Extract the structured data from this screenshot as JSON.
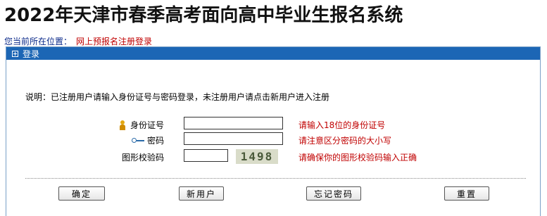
{
  "page": {
    "title": "2022年天津市春季高考面向高中毕业生报名系统",
    "location_label": "您当前所在位置：",
    "location_current": "网上预报名注册登录"
  },
  "panel": {
    "header": "登录",
    "note": "说明：已注册用户请输入身份证号与密码登录，未注册用户请点击新用户进入注册"
  },
  "form": {
    "id_label": "身份证号",
    "id_hint": "请输入18位的身份证号",
    "id_value": "",
    "password_label": "密码",
    "password_hint": "请注意区分密码的大小写",
    "password_value": "",
    "captcha_label": "图形校验码",
    "captcha_hint": "请确保你的图形校验码输入正确",
    "captcha_value": "",
    "captcha_image_text": "1498"
  },
  "buttons": {
    "confirm": "确定",
    "new_user": "新用户",
    "forgot_password": "忘记密码",
    "reset": "重置"
  },
  "colors": {
    "header_bg": "#1c66b5",
    "hint_red": "#c00000",
    "location_blue": "#0b2a8a"
  }
}
